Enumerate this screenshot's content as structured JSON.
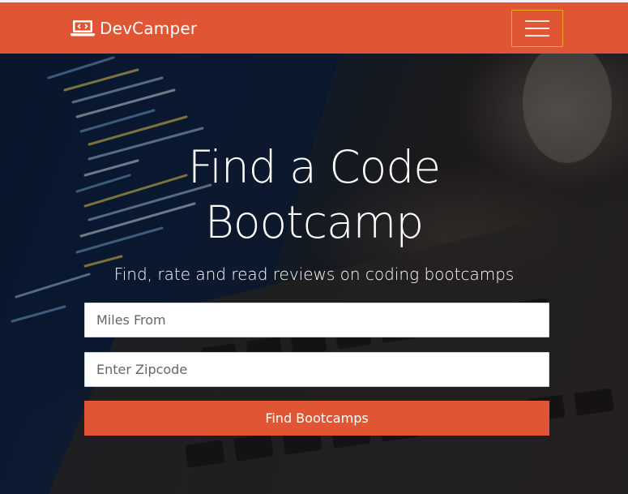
{
  "navbar": {
    "brand_name": "DevCamper",
    "brand_icon": "laptop-code-icon",
    "toggle_icon": "hamburger-menu-icon",
    "accent_color": "#e05533",
    "toggle_border_color": "#f5a623"
  },
  "hero": {
    "title_line1": "Find a Code",
    "title_line2": "Bootcamp",
    "subtitle": "Find, rate and read reviews on coding bootcamps",
    "miles_placeholder": "Miles From",
    "zip_placeholder": "Enter Zipcode",
    "submit_label": "Find Bootcamps"
  }
}
